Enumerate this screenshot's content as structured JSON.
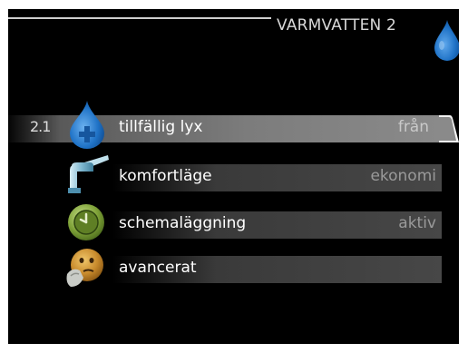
{
  "header": {
    "title": "VARMVATTEN 2",
    "icon": "water-drop-icon"
  },
  "menu": {
    "items": [
      {
        "number": "2.1",
        "label": "tillfällig lyx",
        "value": "från",
        "icon": "water-drop-plus-icon",
        "selected": true
      },
      {
        "label": "komfortläge",
        "value": "ekonomi",
        "icon": "faucet-icon"
      },
      {
        "label": "schemaläggning",
        "value": "aktiv",
        "icon": "clock-icon"
      },
      {
        "label": "avancerat",
        "value": "",
        "icon": "thinking-face-icon"
      }
    ]
  },
  "colors": {
    "background": "#000000",
    "accent_blue": "#1f72c6",
    "text": "#ffffff",
    "value_text": "#9a9a9a"
  }
}
